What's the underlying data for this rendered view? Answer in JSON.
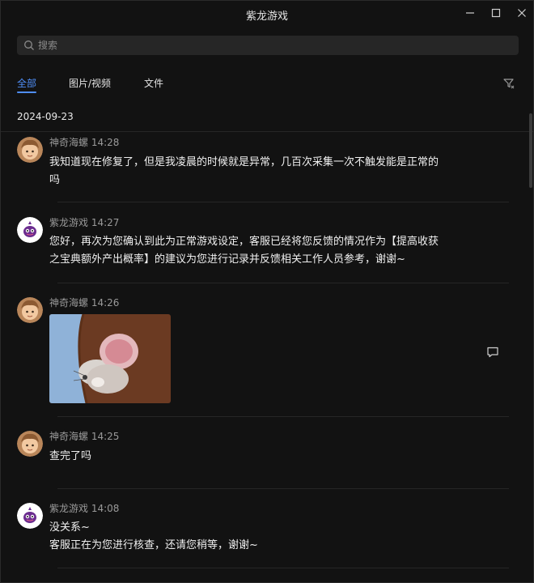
{
  "window": {
    "title": "紫龙游戏"
  },
  "search": {
    "placeholder": "搜索"
  },
  "tabs": [
    {
      "label": "全部",
      "active": true
    },
    {
      "label": "图片/视频",
      "active": false
    },
    {
      "label": "文件",
      "active": false
    }
  ],
  "date_header": "2024-09-23",
  "colors": {
    "accent": "#4f8ef7",
    "background": "#121212",
    "divider": "#262626"
  },
  "messages": [
    {
      "sender": "神奇海螺",
      "time": "14:28",
      "avatar": "user-avatar",
      "lines": [
        "我知道现在修复了，但是我凌晨的时候就是异常，几百次采集一次不触发能是正常的",
        "吗"
      ]
    },
    {
      "sender": "紫龙游戏",
      "time": "14:27",
      "avatar": "support-avatar",
      "lines": [
        "您好，再次为您确认到此为正常游戏设定，客服已经将您反馈的情况作为【提高收获",
        "之宝典额外产出概率】的建议为您进行记录并反馈相关工作人员参考，谢谢~"
      ]
    },
    {
      "sender": "神奇海螺",
      "time": "14:26",
      "avatar": "user-avatar",
      "image": "cartoon-mouse-image"
    },
    {
      "sender": "神奇海螺",
      "time": "14:25",
      "avatar": "user-avatar",
      "lines": [
        "查完了吗"
      ]
    },
    {
      "sender": "紫龙游戏",
      "time": "14:08",
      "avatar": "support-avatar",
      "lines": [
        "没关系~",
        "客服正在为您进行核查，还请您稍等，谢谢~"
      ]
    }
  ]
}
